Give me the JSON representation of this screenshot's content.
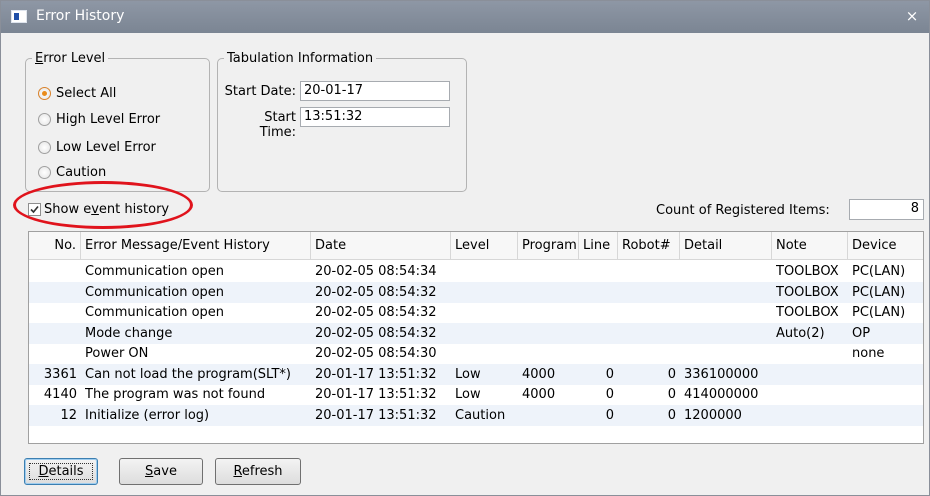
{
  "window": {
    "title": "Error History",
    "close_glyph": "×"
  },
  "error_level": {
    "legend": {
      "accel": "E",
      "rest": "rror Level"
    },
    "options": [
      "Select All",
      "High Level Error",
      "Low Level Error",
      "Caution"
    ],
    "selected_index": 0
  },
  "tabulation": {
    "legend": "Tabulation Information",
    "start_date_label": "Start Date:",
    "start_date": "20-01-17",
    "start_time_label": "Start Time:",
    "start_time": "13:51:32"
  },
  "show_event_history": {
    "pre": "Show e",
    "accel": "v",
    "post": "ent history",
    "checked": true
  },
  "count": {
    "label": "Count of Registered Items:",
    "value": "8"
  },
  "table": {
    "columns": [
      "No.",
      "Error Message/Event History",
      "Date",
      "Level",
      "Program",
      "Line",
      "Robot#",
      "Detail",
      "Note",
      "Device"
    ],
    "rows": [
      {
        "no": "",
        "msg": "Communication open",
        "date": "20-02-05 08:54:34",
        "level": "",
        "program": "",
        "line": "",
        "robot": "",
        "detail": "",
        "note": "TOOLBOX",
        "device": "PC(LAN)"
      },
      {
        "no": "",
        "msg": "Communication open",
        "date": "20-02-05 08:54:32",
        "level": "",
        "program": "",
        "line": "",
        "robot": "",
        "detail": "",
        "note": "TOOLBOX",
        "device": "PC(LAN)"
      },
      {
        "no": "",
        "msg": "Communication open",
        "date": "20-02-05 08:54:32",
        "level": "",
        "program": "",
        "line": "",
        "robot": "",
        "detail": "",
        "note": "TOOLBOX",
        "device": "PC(LAN)"
      },
      {
        "no": "",
        "msg": "Mode change",
        "date": "20-02-05 08:54:32",
        "level": "",
        "program": "",
        "line": "",
        "robot": "",
        "detail": "",
        "note": "Auto(2)",
        "device": "OP"
      },
      {
        "no": "",
        "msg": "Power ON",
        "date": "20-02-05 08:54:30",
        "level": "",
        "program": "",
        "line": "",
        "robot": "",
        "detail": "",
        "note": "",
        "device": "none"
      },
      {
        "no": "3361",
        "msg": "Can not load the program(SLT*)",
        "date": "20-01-17 13:51:32",
        "level": "Low",
        "program": "4000",
        "line": "0",
        "robot": "0",
        "detail": "336100000",
        "note": "",
        "device": ""
      },
      {
        "no": "4140",
        "msg": "The program was not found",
        "date": "20-01-17 13:51:32",
        "level": "Low",
        "program": "4000",
        "line": "0",
        "robot": "0",
        "detail": "414000000",
        "note": "",
        "device": ""
      },
      {
        "no": "12",
        "msg": "Initialize (error log)",
        "date": "20-01-17 13:51:32",
        "level": "Caution",
        "program": "",
        "line": "0",
        "robot": "0",
        "detail": "1200000",
        "note": "",
        "device": ""
      }
    ]
  },
  "buttons": {
    "details": {
      "accel": "D",
      "rest": "etails"
    },
    "save": {
      "accel": "S",
      "rest": "ave"
    },
    "refresh": {
      "accel": "R",
      "rest": "efresh"
    }
  },
  "colors": {
    "titlebar": "#7f8896",
    "highlight": "#e0131c",
    "row_alt": "#eef3fa",
    "radio_selected": "#e98b1a"
  }
}
